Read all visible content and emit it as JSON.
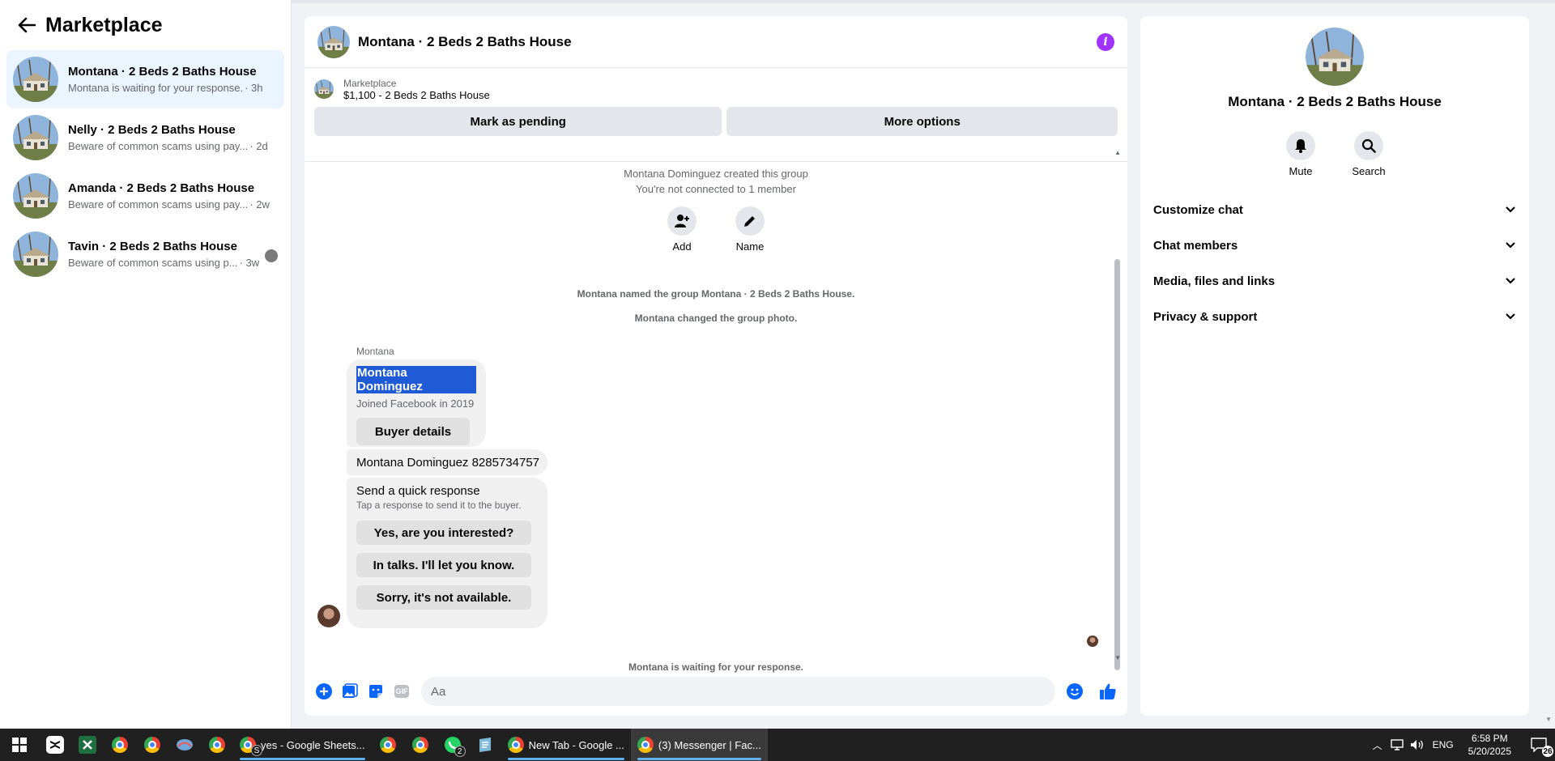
{
  "sidebar": {
    "title": "Marketplace",
    "conversations": [
      {
        "name": "Montana · 2 Beds 2 Baths House",
        "preview": "Montana is waiting for your response.",
        "time": "· 3h"
      },
      {
        "name": "Nelly · 2 Beds 2 Baths House",
        "preview": "Beware of common scams using pay...",
        "time": "· 2d"
      },
      {
        "name": "Amanda · 2 Beds 2 Baths House",
        "preview": "Beware of common scams using pay...",
        "time": "· 2w"
      },
      {
        "name": "Tavin · 2 Beds 2 Baths House",
        "preview": "Beware of common scams using p...",
        "time": "· 3w"
      }
    ]
  },
  "chat": {
    "title": "Montana · 2 Beds 2 Baths House",
    "listing": {
      "source": "Marketplace",
      "price_title": "$1,100 - 2 Beds 2 Baths House"
    },
    "mark_pending": "Mark as pending",
    "more_options": "More options",
    "created": "Montana Dominguez created this group",
    "not_connected": "You're not connected to 1 member",
    "add_label": "Add",
    "name_label": "Name",
    "named_notice": "Montana named the group Montana · 2 Beds 2 Baths House.",
    "photo_notice": "Montana changed the group photo.",
    "sender": "Montana",
    "buyer": {
      "name": "Montana Dominguez",
      "joined": "Joined Facebook in 2019",
      "button": "Buyer details"
    },
    "phone_message": "Montana Dominguez 8285734757",
    "quick": {
      "title": "Send a quick response",
      "subtitle": "Tap a response to send it to the buyer.",
      "options": [
        "Yes, are you interested?",
        "In talks. I'll let you know.",
        "Sorry, it's not available."
      ]
    },
    "waiting": "Montana is waiting for your response.",
    "composer_placeholder": "Aa",
    "gif_label": "GIF"
  },
  "panel": {
    "title": "Montana · 2 Beds 2 Baths House",
    "mute": "Mute",
    "search": "Search",
    "sections": [
      "Customize chat",
      "Chat members",
      "Media, files and links",
      "Privacy & support"
    ]
  },
  "taskbar": {
    "sheets_task": "yes - Google Sheets...",
    "newtab_task": "New Tab - Google ...",
    "messenger_task": "(3) Messenger | Fac...",
    "whatsapp_badge": "2",
    "sheets_badge": "S",
    "lang": "ENG",
    "time": "6:58 PM",
    "date": "5/20/2025",
    "notif_count": "26"
  },
  "colors": {
    "accent": "#0866ff",
    "info": "#a033ff",
    "selection": "#1f5bd6"
  }
}
